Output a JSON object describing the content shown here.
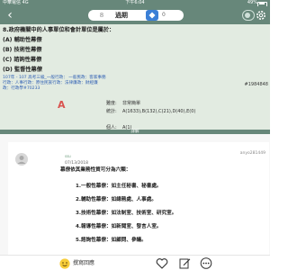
{
  "status_bar": {
    "carrier": "中華電信  4G",
    "time": "下午6:04",
    "battery": "49%"
  },
  "top_bar": {
    "page_indicator": "8",
    "mode_label": "過期",
    "gem_count": "0"
  },
  "question": {
    "title": "8.政府機關中的人事單位和會計單位是屬於：",
    "options": [
      "(A) 輔助性幕僚",
      "(B) 技術性幕僚",
      "(C) 諮詢性幕僚",
      "(D) 監督性幕僚"
    ],
    "tags": [
      "107年 - 107 高考三級_一般行政： 一般民政：客家事務",
      "行政：人事行政：原住民族行政：法律廉政：財經廉",
      "政：行政學#70233"
    ],
    "id_label": "#1984848"
  },
  "answer": {
    "correct": "A",
    "rows": [
      {
        "key": "難度:",
        "value": "非常簡單"
      },
      {
        "key": "統計:",
        "value": "A(1633),B(132),C(21),D(40),E(0)"
      },
      {
        "key": "",
        "value": ""
      },
      {
        "key": "個人:",
        "value": "A(1)"
      }
    ]
  },
  "divider_label": "詳解",
  "comment": {
    "username": "ssu",
    "date": "07/13/2018",
    "user_id": "anyo281449",
    "lines": [
      "幕僚依其業務性質可分為六類：",
      "1.一般性幕僚：如主任秘書、秘書處。",
      "2.輔助性幕僚：如總務處、人事處。",
      "3.技術性幕僚：如法制室、技術室、研究室。",
      "4.報導性幕僚：如新聞室、發言人室。",
      "5.諮詢性幕僚：如顧問、參議。"
    ]
  },
  "bottom_bar": {
    "write_label": "撰寫回應"
  }
}
